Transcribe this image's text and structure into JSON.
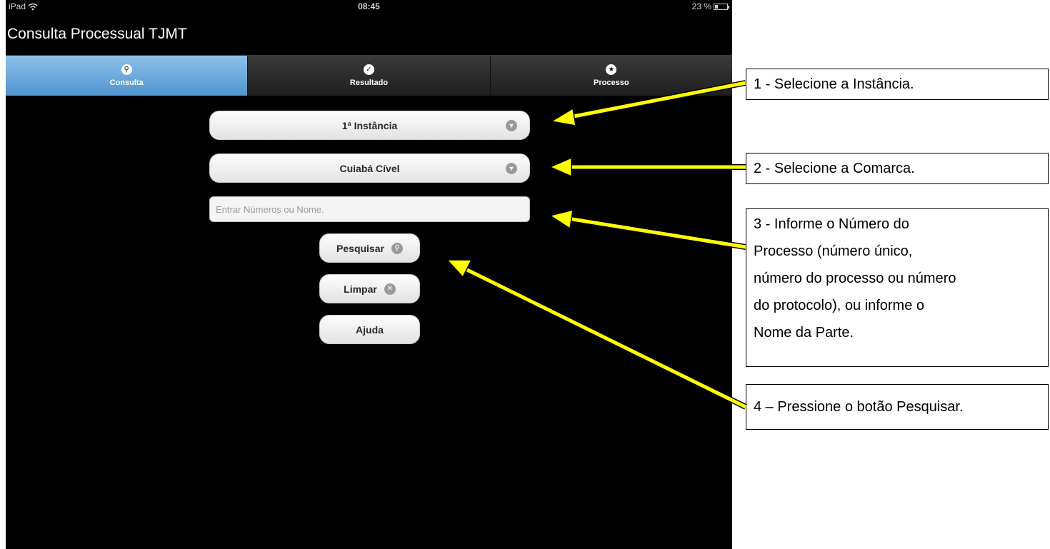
{
  "status_bar": {
    "device": "iPad",
    "time": "08:45",
    "battery": "23 %"
  },
  "app": {
    "title": "Consulta Processual TJMT"
  },
  "tabs": [
    {
      "label": "Consulta",
      "icon": "search-icon",
      "active": true
    },
    {
      "label": "Resultado",
      "icon": "check-icon",
      "active": false
    },
    {
      "label": "Processo",
      "icon": "star-icon",
      "active": false
    }
  ],
  "form": {
    "instancia": "1ª Instância",
    "comarca": "Cuiabá Cível",
    "search_placeholder": "Entrar Números ou Nome.",
    "search_value": ""
  },
  "buttons": {
    "pesquisar": "Pesquisar",
    "limpar": "Limpar",
    "ajuda": "Ajuda"
  },
  "callouts": [
    {
      "text": "1 - Selecione a Instância."
    },
    {
      "text": "2 - Selecione a Comarca."
    },
    {
      "lines": [
        "3 - Informe o Número do",
        "Processo (número único,",
        "número do processo ou número",
        "do protocolo), ou informe o",
        "Nome da Parte."
      ]
    },
    {
      "text": "4 – Pressione o botão Pesquisar."
    }
  ],
  "colors": {
    "arrow": "#ffff00",
    "active_tab": "#5a9fd6",
    "screen_bg": "#000000"
  }
}
